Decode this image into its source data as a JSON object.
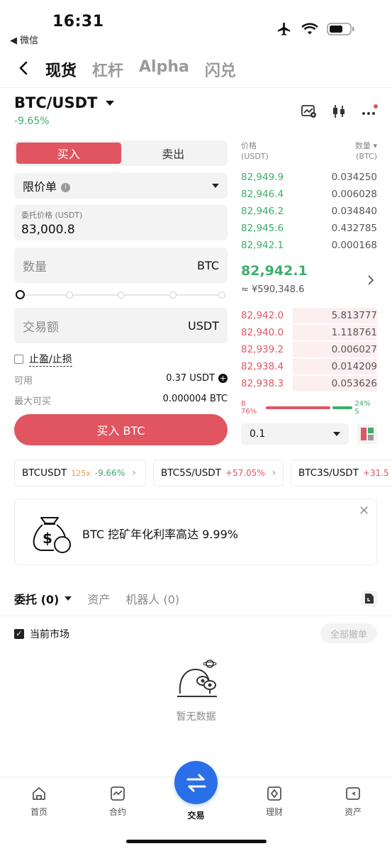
{
  "status_bar": {
    "time": "16:31",
    "back_app": "◀ 微信"
  },
  "nav": {
    "tabs": [
      "现货",
      "杠杆",
      "Alpha",
      "闪兑"
    ]
  },
  "pair": {
    "name": "BTC/USDT",
    "change": "-9.65%"
  },
  "order_form": {
    "buy_label": "买入",
    "sell_label": "卖出",
    "order_type": "限价单",
    "price_label": "委托价格 (USDT)",
    "price_value": "83,000.8",
    "qty_placeholder": "数量",
    "qty_unit": "BTC",
    "amount_placeholder": "交易额",
    "amount_unit": "USDT",
    "tpsl_label": "止盈/止损",
    "available_label": "可用",
    "available_value": "0.37 USDT",
    "max_buy_label": "最大可买",
    "max_buy_value": "0.000004 BTC",
    "submit_label": "买入 BTC"
  },
  "order_book": {
    "price_header": "价格",
    "price_unit": "(USDT)",
    "qty_header": "数量",
    "qty_unit": "(BTC)",
    "asks": [
      {
        "price": "82,949.9",
        "qty": "0.034250"
      },
      {
        "price": "82,946.4",
        "qty": "0.006028"
      },
      {
        "price": "82,946.2",
        "qty": "0.034840"
      },
      {
        "price": "82,945.6",
        "qty": "0.432785"
      },
      {
        "price": "82,942.1",
        "qty": "0.000168"
      }
    ],
    "mid_price": "82,942.1",
    "mid_cny": "≈ ¥590,348.6",
    "bids": [
      {
        "price": "82,942.0",
        "qty": "5.813777",
        "depth": 0.62
      },
      {
        "price": "82,940.0",
        "qty": "1.118761",
        "depth": 0.62
      },
      {
        "price": "82,939.2",
        "qty": "0.006027",
        "depth": 0.62
      },
      {
        "price": "82,938.4",
        "qty": "0.014209",
        "depth": 0.62
      },
      {
        "price": "82,938.3",
        "qty": "0.053626",
        "depth": 0.62
      }
    ],
    "buy_ratio_label": "B 76%",
    "sell_ratio_label": "24% S",
    "buy_ratio": 0.76,
    "depth_value": "0.1"
  },
  "related_pairs": [
    {
      "name": "BTCUSDT",
      "leverage": "125x",
      "change": "-9.66%"
    },
    {
      "name": "BTC5S/USDT",
      "leverage": "",
      "change": "+57.05%"
    },
    {
      "name": "BTC3S/USDT",
      "leverage": "",
      "change": "+31.5"
    }
  ],
  "banner": {
    "text": "BTC 挖矿年化利率高达 9.99%"
  },
  "orders": {
    "tab_orders": "委托 (0)",
    "tab_assets": "资产",
    "tab_bots": "机器人 (0)",
    "current_market": "当前市场",
    "cancel_all": "全部撤单",
    "empty": "暂无数据"
  },
  "tabbar": {
    "home": "首页",
    "futures": "合约",
    "trade": "交易",
    "earn": "理财",
    "assets": "资产"
  },
  "colors": {
    "buy": "#e15561",
    "up": "#3aae6b",
    "accent": "#2b6fe8"
  }
}
